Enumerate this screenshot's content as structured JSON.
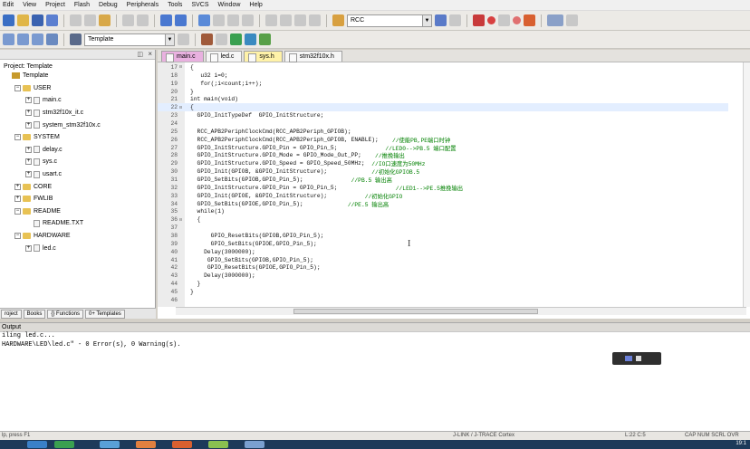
{
  "menu": [
    "Edit",
    "View",
    "Project",
    "Flash",
    "Debug",
    "Peripherals",
    "Tools",
    "SVCS",
    "Window",
    "Help"
  ],
  "toolbar": {
    "find_value": "RCC",
    "target_value": "Template"
  },
  "project_panel": {
    "title": "Project: Template",
    "tree": [
      {
        "label": "Template",
        "level": 0,
        "kind": "project",
        "expander": ""
      },
      {
        "label": "USER",
        "level": 1,
        "kind": "folder",
        "expander": "−"
      },
      {
        "label": "main.c",
        "level": 2,
        "kind": "file",
        "expander": "+"
      },
      {
        "label": "stm32f10x_it.c",
        "level": 2,
        "kind": "file",
        "expander": "+"
      },
      {
        "label": "system_stm32f10x.c",
        "level": 2,
        "kind": "file",
        "expander": "+"
      },
      {
        "label": "SYSTEM",
        "level": 1,
        "kind": "folder",
        "expander": "−"
      },
      {
        "label": "delay.c",
        "level": 2,
        "kind": "file",
        "expander": "+"
      },
      {
        "label": "sys.c",
        "level": 2,
        "kind": "file",
        "expander": "+"
      },
      {
        "label": "usart.c",
        "level": 2,
        "kind": "file",
        "expander": "+"
      },
      {
        "label": "CORE",
        "level": 1,
        "kind": "folder",
        "expander": "+"
      },
      {
        "label": "FWLIB",
        "level": 1,
        "kind": "folder",
        "expander": "+"
      },
      {
        "label": "README",
        "level": 1,
        "kind": "folder",
        "expander": "−"
      },
      {
        "label": "README.TXT",
        "level": 2,
        "kind": "file",
        "expander": ""
      },
      {
        "label": "HARDWARE",
        "level": 1,
        "kind": "folder",
        "expander": "−"
      },
      {
        "label": "led.c",
        "level": 2,
        "kind": "file",
        "expander": "+"
      }
    ],
    "bottom_tabs": [
      "roject",
      "Books",
      "{} Functions",
      "0+ Templates"
    ]
  },
  "editor": {
    "tabs": [
      {
        "label": "main.c",
        "style": "active"
      },
      {
        "label": "led.c",
        "style": "white"
      },
      {
        "label": "sys.h",
        "style": "yellow"
      },
      {
        "label": "stm32f10x.h",
        "style": "white"
      }
    ],
    "lines": [
      {
        "n": "17",
        "fold": "⊟",
        "code": "{",
        "comment": ""
      },
      {
        "n": "18",
        "fold": "",
        "code": "   u32 i=0;",
        "comment": ""
      },
      {
        "n": "19",
        "fold": "",
        "code": "   for(;i<count;i++);",
        "comment": ""
      },
      {
        "n": "20",
        "fold": "",
        "code": "}",
        "comment": ""
      },
      {
        "n": "21",
        "fold": "",
        "code": "int main(void)",
        "comment": ""
      },
      {
        "n": "22",
        "fold": "⊟",
        "code": "{",
        "comment": ""
      },
      {
        "n": "23",
        "fold": "",
        "code": "  GPIO_InitTypeDef  GPIO_InitStructure;",
        "comment": ""
      },
      {
        "n": "24",
        "fold": "",
        "code": "",
        "comment": ""
      },
      {
        "n": "25",
        "fold": "",
        "code": "  RCC_APB2PeriphClockCmd(RCC_APB2Periph_GPIOB);",
        "comment": ""
      },
      {
        "n": "26",
        "fold": "",
        "code": "  RCC_APB2PeriphClockCmd(RCC_APB2Periph_GPIOB, ENABLE);",
        "comment": "    //使能PB,PE端口时钟"
      },
      {
        "n": "27",
        "fold": "",
        "code": "  GPIO_InitStructure.GPIO_Pin = GPIO_Pin_5;",
        "comment": "              //LED0-->PB.5 端口配置"
      },
      {
        "n": "28",
        "fold": "",
        "code": "  GPIO_InitStructure.GPIO_Mode = GPIO_Mode_Out_PP;",
        "comment": "    //推挽输出"
      },
      {
        "n": "29",
        "fold": "",
        "code": "  GPIO_InitStructure.GPIO_Speed = GPIO_Speed_50MHz;",
        "comment": "  //IO口速度为50MHz"
      },
      {
        "n": "30",
        "fold": "",
        "code": "  GPIO_Init(GPIOB, &GPIO_InitStructure);",
        "comment": "             //初始化GPIOB.5"
      },
      {
        "n": "31",
        "fold": "",
        "code": "  GPIO_SetBits(GPIOB,GPIO_Pin_5);",
        "comment": "              //PB.5 输出高"
      },
      {
        "n": "32",
        "fold": "",
        "code": "  GPIO_InitStructure.GPIO_Pin = GPIO_Pin_5;",
        "comment": "                 //LED1-->PE.5推挽输出"
      },
      {
        "n": "33",
        "fold": "",
        "code": "  GPIO_Init(GPIOE, &GPIO_InitStructure);",
        "comment": "           //初始化GPIO"
      },
      {
        "n": "34",
        "fold": "",
        "code": "  GPIO_SetBits(GPIOE,GPIO_Pin_5);",
        "comment": "             //PE.5 输出高"
      },
      {
        "n": "35",
        "fold": "",
        "code": "  while(1)",
        "comment": ""
      },
      {
        "n": "36",
        "fold": "⊟",
        "code": "  {",
        "comment": ""
      },
      {
        "n": "37",
        "fold": "",
        "code": "",
        "comment": ""
      },
      {
        "n": "38",
        "fold": "",
        "code": "      GPIO_ResetBits(GPIOB,GPIO_Pin_5);",
        "comment": ""
      },
      {
        "n": "39",
        "fold": "",
        "code": "      GPIO_SetBits(GPIOE,GPIO_Pin_5);",
        "comment": ""
      },
      {
        "n": "40",
        "fold": "",
        "code": "    Delay(3000000);",
        "comment": ""
      },
      {
        "n": "41",
        "fold": "",
        "code": "     GPIO_SetBits(GPIOB,GPIO_Pin_5);",
        "comment": ""
      },
      {
        "n": "42",
        "fold": "",
        "code": "     GPIO_ResetBits(GPIOE,GPIO_Pin_5);",
        "comment": ""
      },
      {
        "n": "43",
        "fold": "",
        "code": "    Delay(3000000);",
        "comment": ""
      },
      {
        "n": "44",
        "fold": "",
        "code": "  }",
        "comment": ""
      },
      {
        "n": "45",
        "fold": "",
        "code": "}",
        "comment": ""
      },
      {
        "n": "46",
        "fold": "",
        "code": "",
        "comment": ""
      }
    ]
  },
  "output": {
    "title": "Output",
    "lines": [
      "iling led.c...",
      "HARDWARE\\LED\\led.c\" - 0 Error(s), 0 Warning(s)."
    ]
  },
  "status": {
    "left": "lp, press F1",
    "debugger": "J-LINK / J-TRACE Cortex",
    "position": "L:22 C:5",
    "flags": "CAP NUM SCRL OVR",
    "time": "19:1"
  },
  "colors": {
    "active_tab": "#e9b1e0",
    "comment": "#008000",
    "taskbar": "#1d3a5a"
  }
}
